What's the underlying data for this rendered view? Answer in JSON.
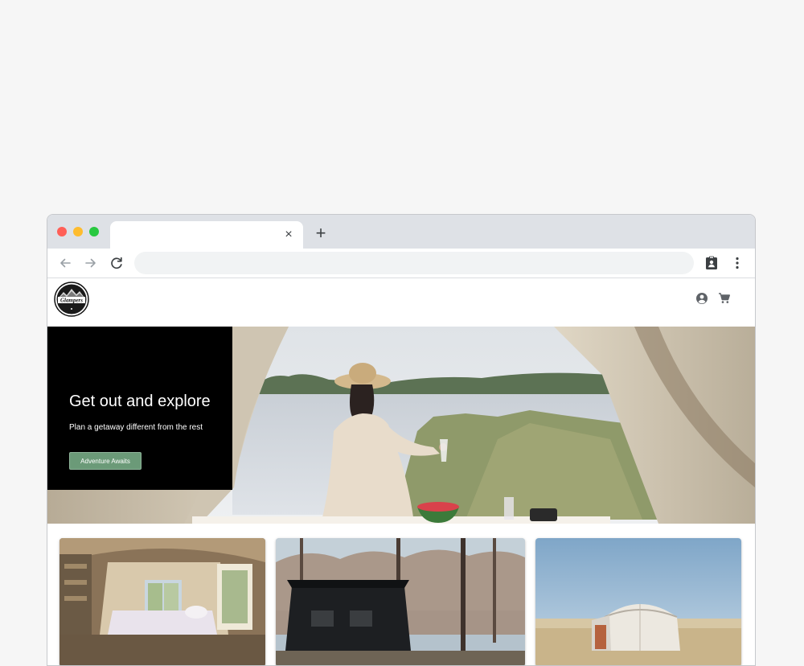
{
  "browser": {
    "tab_title": "",
    "tab_close": "×",
    "new_tab": "+",
    "url": "",
    "url_placeholder": ""
  },
  "site": {
    "logo_text": "Glampers"
  },
  "hero": {
    "title": "Get out and explore",
    "subtitle": "Plan a getaway different from the rest",
    "cta_label": "Adventure Awaits"
  },
  "cards": [
    {
      "name": "shepherd-hut-interior"
    },
    {
      "name": "black-cabin-in-forest"
    },
    {
      "name": "yurt-on-plains"
    }
  ],
  "colors": {
    "close_dot": "#ff5f57",
    "minimize_dot": "#febc2e",
    "zoom_dot": "#28c840",
    "cta": "#6b9a78",
    "hero_panel": "#000000"
  },
  "icons": {
    "back": "arrow-left-icon",
    "forward": "arrow-right-icon",
    "reload": "reload-icon",
    "extension": "clipboard-account-icon",
    "menu": "kebab-menu-icon",
    "account": "account-circle-icon",
    "cart": "shopping-cart-icon"
  }
}
